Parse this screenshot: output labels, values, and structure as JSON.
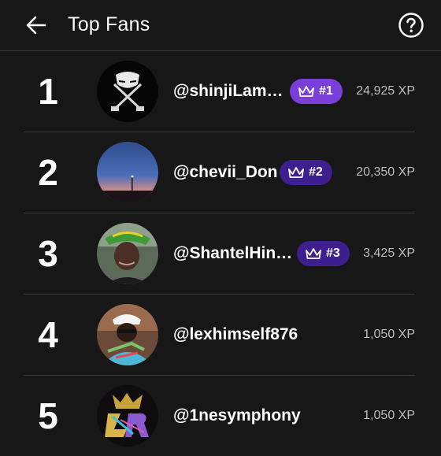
{
  "header": {
    "title": "Top Fans"
  },
  "fans": [
    {
      "rank": "1",
      "username": "@shinjiLam…",
      "badge": "#1",
      "xp": "24,925 XP"
    },
    {
      "rank": "2",
      "username": "@chevii_Don",
      "badge": "#2",
      "xp": "20,350 XP"
    },
    {
      "rank": "3",
      "username": "@ShantelHin…",
      "badge": "#3",
      "xp": "3,425 XP"
    },
    {
      "rank": "4",
      "username": "@lexhimself876",
      "badge": "",
      "xp": "1,050 XP"
    },
    {
      "rank": "5",
      "username": "@1nesymphony",
      "badge": "",
      "xp": "1,050 XP"
    }
  ],
  "icons": {
    "back": "arrow-left-icon",
    "help": "help-circle-icon",
    "crown": "crown-icon"
  },
  "colors": {
    "background": "#171717",
    "badge_primary": "#7a3fd8",
    "badge_secondary": "#3d1f8f",
    "xp_text": "#bdbdbd"
  }
}
